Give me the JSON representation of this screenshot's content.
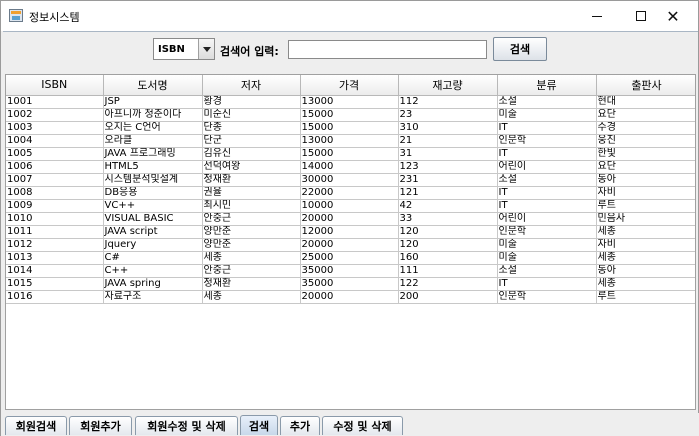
{
  "window": {
    "title": "정보시스템",
    "minimize": "—",
    "close": "✕"
  },
  "search": {
    "field_selected": "ISBN",
    "label": "검색어 입력:",
    "input_value": "",
    "button_label": "검색"
  },
  "table": {
    "columns": [
      "ISBN",
      "도서명",
      "저자",
      "가격",
      "재고량",
      "분류",
      "출판사"
    ],
    "rows": [
      [
        "1001",
        "JSP",
        "황경",
        "13000",
        "112",
        "소설",
        "현대"
      ],
      [
        "1002",
        "아프니까 청춘이다",
        "미순신",
        "15000",
        "23",
        "미술",
        "요단"
      ],
      [
        "1003",
        "오지는 C언어",
        "단종",
        "15000",
        "310",
        "IT",
        "수경"
      ],
      [
        "1004",
        "오라클",
        "단군",
        "13000",
        "21",
        "인문학",
        "웅진"
      ],
      [
        "1005",
        "JAVA 프로그래밍",
        "김유신",
        "15000",
        "31",
        "IT",
        "한빛"
      ],
      [
        "1006",
        "HTML5",
        "선덕여왕",
        "14000",
        "123",
        "어린이",
        "요단"
      ],
      [
        "1007",
        "시스템분석및설계",
        "정재환",
        "30000",
        "231",
        "소설",
        "동아"
      ],
      [
        "1008",
        "DB응용",
        "권율",
        "22000",
        "121",
        "IT",
        "자비"
      ],
      [
        "1009",
        "VC++",
        "최시민",
        "10000",
        "42",
        "IT",
        "루트"
      ],
      [
        "1010",
        "VISUAL BASIC",
        "안중근",
        "20000",
        "33",
        "어린이",
        "민음사"
      ],
      [
        "1011",
        "JAVA script",
        "양만춘",
        "12000",
        "120",
        "인문학",
        "세종"
      ],
      [
        "1012",
        "Jquery",
        "양만춘",
        "20000",
        "120",
        "미술",
        "자비"
      ],
      [
        "1013",
        "C#",
        "세종",
        "25000",
        "160",
        "미술",
        "세종"
      ],
      [
        "1014",
        "C++",
        "안중근",
        "35000",
        "111",
        "소설",
        "동아"
      ],
      [
        "1015",
        "JAVA spring",
        "정재환",
        "35000",
        "122",
        "IT",
        "세종"
      ],
      [
        "1016",
        "자료구조",
        "세종",
        "20000",
        "200",
        "인문학",
        "루트"
      ]
    ]
  },
  "tabs": [
    {
      "label": "회원검색",
      "active": false
    },
    {
      "label": "회원추가",
      "active": false
    },
    {
      "label": "회원수정 및 삭제",
      "active": false
    },
    {
      "label": "검색",
      "active": true
    },
    {
      "label": "추가",
      "active": false
    },
    {
      "label": "수정 및 삭제",
      "active": false
    }
  ],
  "colors": {
    "tab_border": "#8a9aaa",
    "active_tab": "#c8d8ea",
    "grid_line": "#c8c8c8"
  }
}
